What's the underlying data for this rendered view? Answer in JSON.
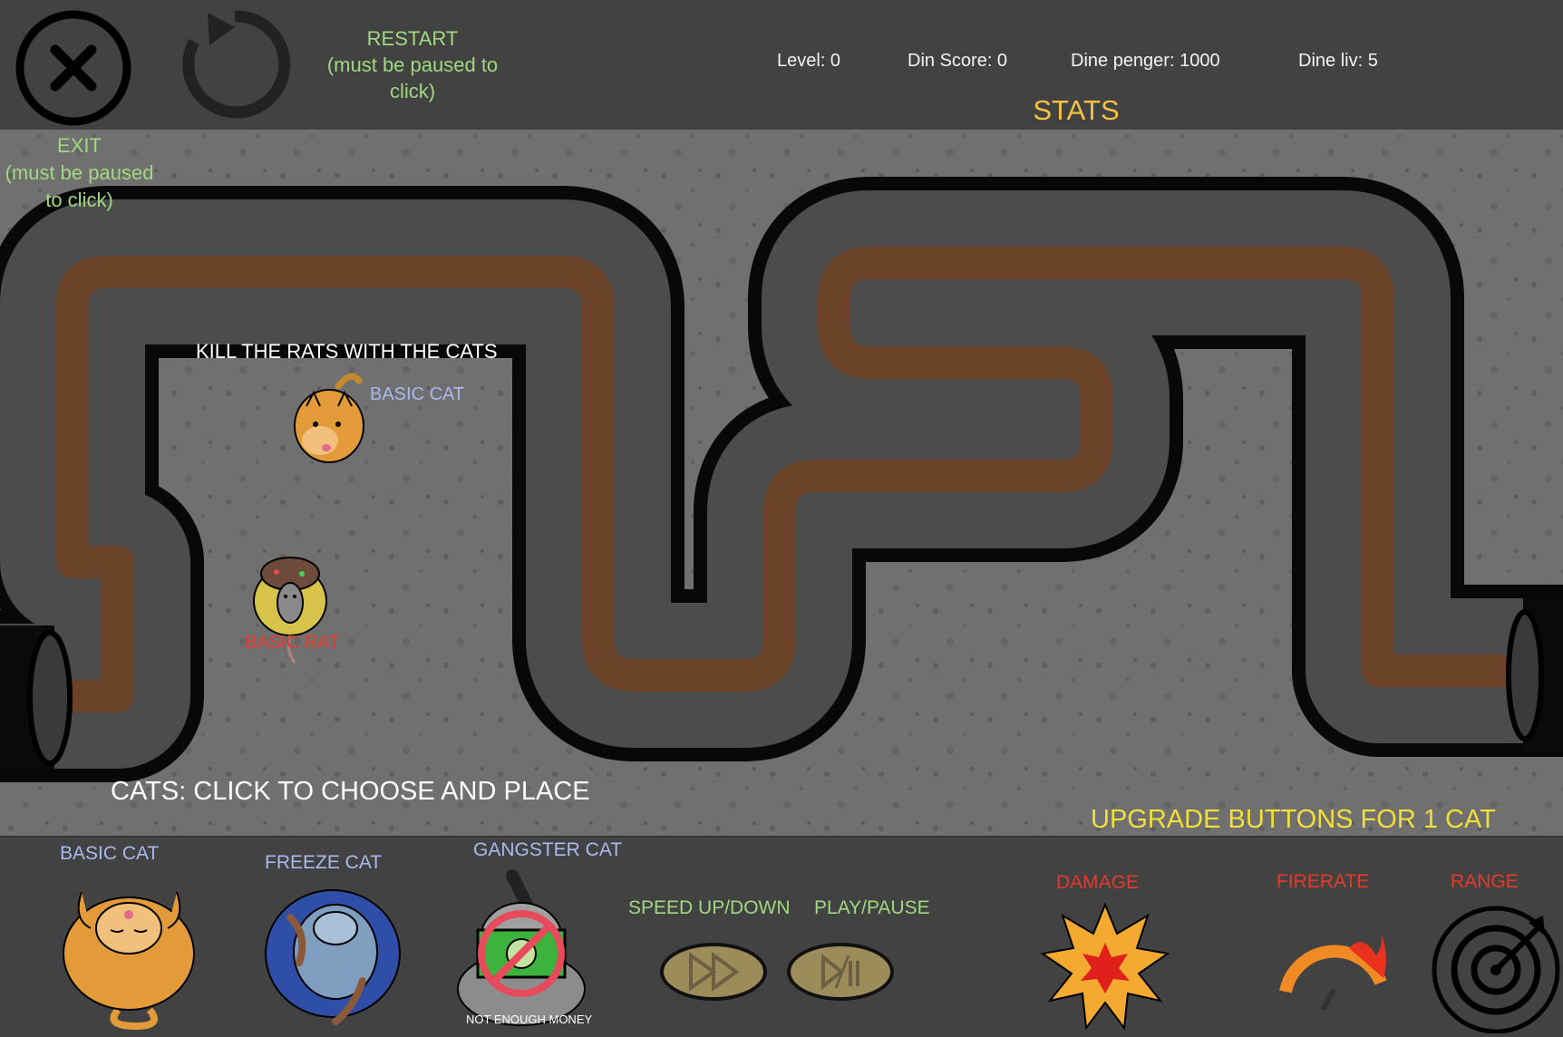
{
  "toolbar": {
    "restart_label": "RESTART\n(must be paused to\nclick)",
    "exit_label": "EXIT\n(must be paused\nto click)"
  },
  "stats": {
    "level": "Level: 0",
    "score": "Din Score: 0",
    "money": "Dine penger: 1000",
    "lives": "Dine liv: 5",
    "title": "STATS"
  },
  "tutorial": {
    "kill_text": "KILL THE RATS WITH THE CATS",
    "basic_cat_label": "BASIC CAT",
    "basic_rat_label": "BASIC RAT",
    "cats_instruction": "CATS: CLICK TO CHOOSE AND PLACE",
    "upgrade_instruction": "UPGRADE BUTTONS FOR 1 CAT"
  },
  "shop": {
    "basic_cat": "BASIC CAT",
    "freeze_cat": "FREEZE CAT",
    "gangster_cat": "GANGSTER CAT",
    "not_enough_money": "NOT ENOUGH MONEY"
  },
  "controls": {
    "speed": "SPEED UP/DOWN",
    "play_pause": "PLAY/PAUSE"
  },
  "upgrades": {
    "damage": "DAMAGE",
    "firerate": "FIRERATE",
    "range": "RANGE"
  },
  "colors": {
    "instruction_green": "#9fd87f",
    "label_blue": "#a9b9ee",
    "label_red": "#e53a2a",
    "label_yellow": "#f3df3a"
  }
}
